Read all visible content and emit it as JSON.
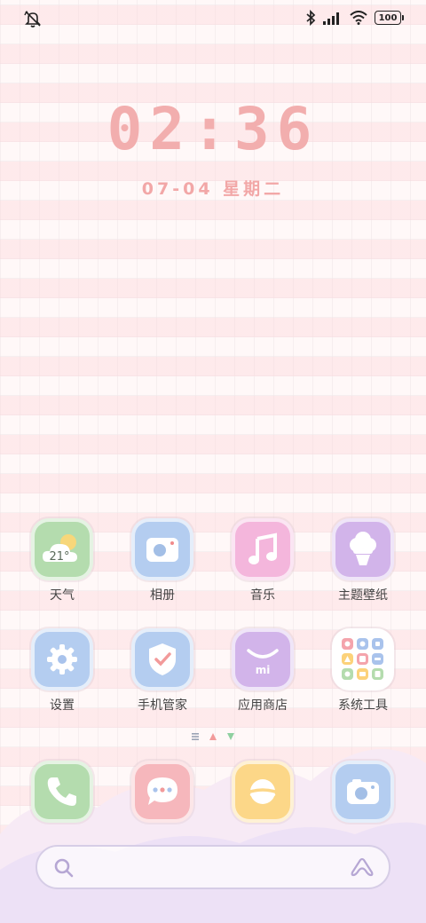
{
  "status_bar": {
    "left_icon": "bell-off-icon",
    "right_icons": [
      "bluetooth-icon",
      "signal-icon",
      "wifi-icon"
    ],
    "battery_level": "100"
  },
  "lock_clock": {
    "time": "02:36",
    "date": "07-04 星期二"
  },
  "apps": [
    {
      "label": "天气",
      "icon": "weather-icon",
      "temp": "21°"
    },
    {
      "label": "相册",
      "icon": "gallery-icon"
    },
    {
      "label": "音乐",
      "icon": "music-icon"
    },
    {
      "label": "主题壁纸",
      "icon": "themes-icon"
    },
    {
      "label": "设置",
      "icon": "settings-icon"
    },
    {
      "label": "手机管家",
      "icon": "security-icon"
    },
    {
      "label": "应用商店",
      "icon": "app-store-icon",
      "logo_text": "mi"
    },
    {
      "label": "系统工具",
      "icon": "system-tools-folder-icon"
    }
  ],
  "page_indicator": {
    "icons": [
      "menu-lines-icon",
      "page-dot-active-icon",
      "page-dot-icon"
    ]
  },
  "dock": [
    {
      "icon": "phone-icon"
    },
    {
      "icon": "messages-icon"
    },
    {
      "icon": "browser-icon"
    },
    {
      "icon": "camera-icon"
    }
  ],
  "search": {
    "icon": "search-icon",
    "assistant_icon": "assistant-icon"
  },
  "colors": {
    "accent_pink": "#f2aeae",
    "green": "#b4dcae",
    "blue": "#b4cdf0",
    "purple": "#d2b4ea"
  }
}
